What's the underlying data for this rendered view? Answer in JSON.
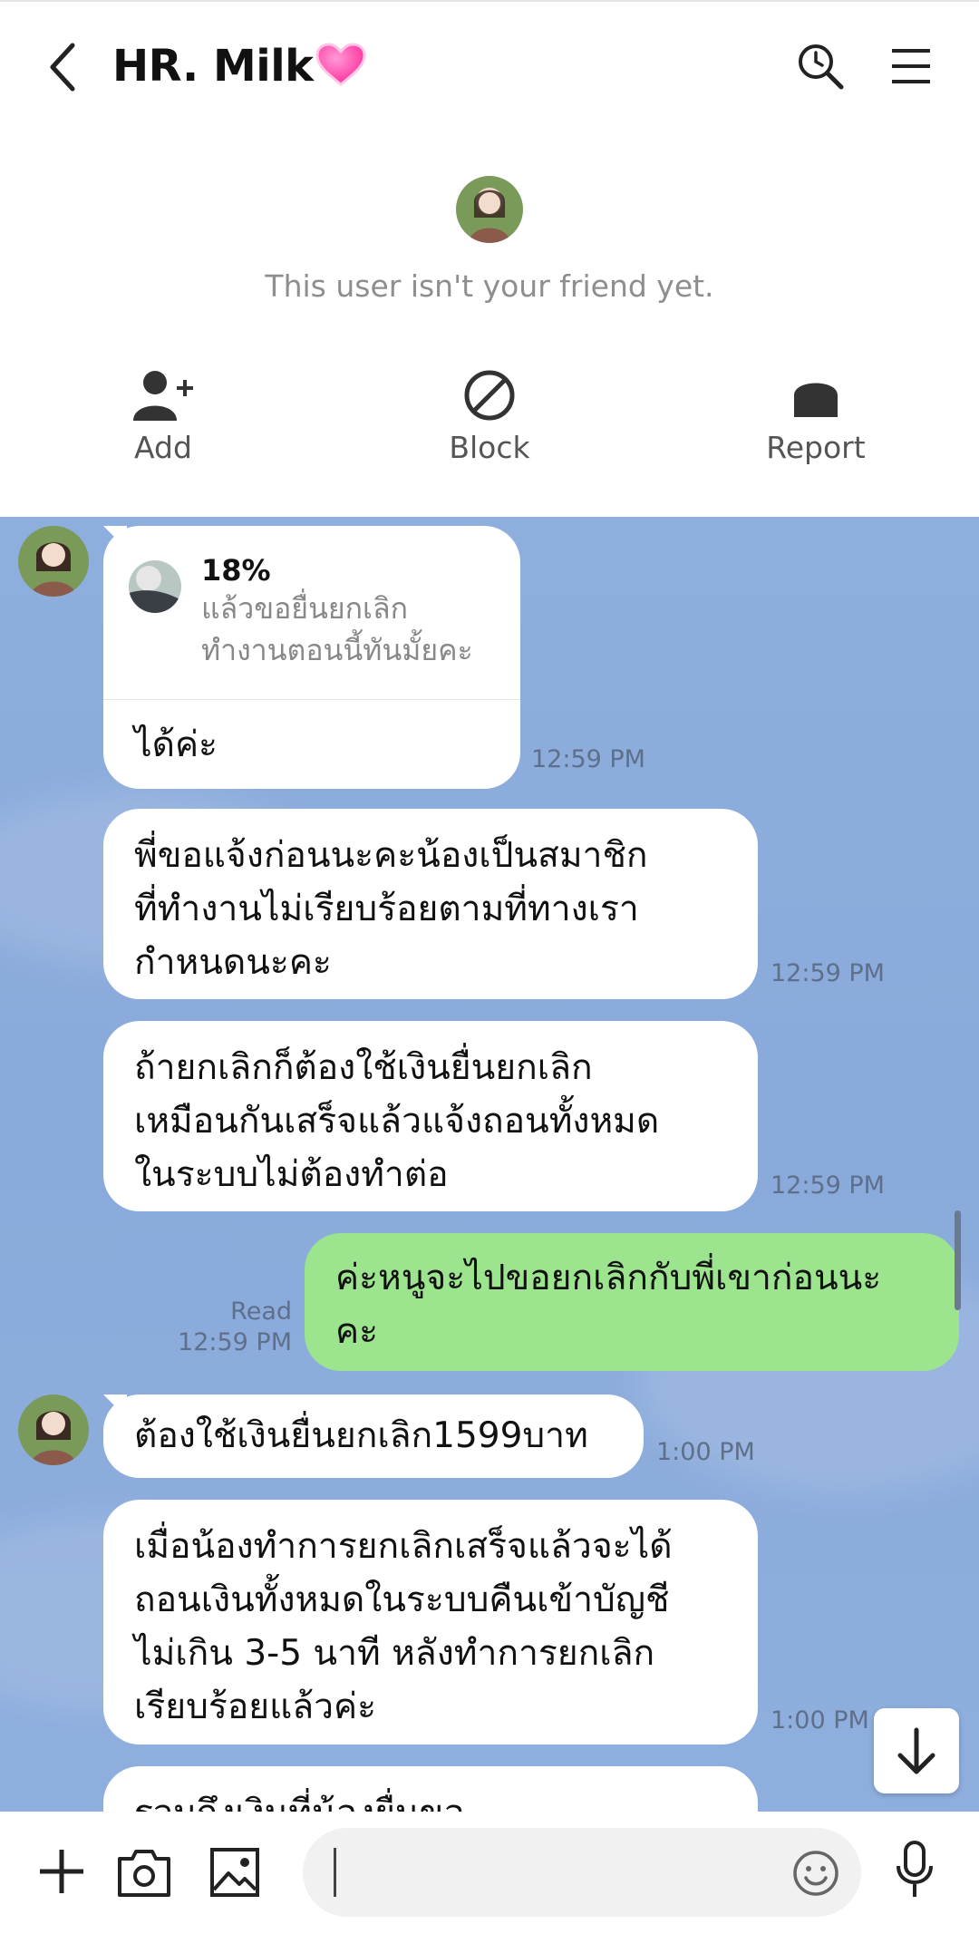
{
  "header": {
    "title": "HR. Milk"
  },
  "profile": {
    "status_text": "This user isn't your friend yet.",
    "actions": [
      {
        "label": "Add",
        "icon": "add-friend-icon"
      },
      {
        "label": "Block",
        "icon": "block-icon"
      },
      {
        "label": "Report",
        "icon": "report-icon"
      }
    ]
  },
  "messages": [
    {
      "from": "them",
      "reply_to": {
        "title": "18%",
        "line1": "แล้วขอยื่นยกเลิก",
        "line2": "ทำงานตอนนี้ทันมั้ยคะ"
      },
      "text": "ได้ค่ะ",
      "time": "12:59 PM"
    },
    {
      "from": "them",
      "lines": [
        "พี่ขอแจ้งก่อนนะคะน้องเป็นสมาชิก",
        "ที่ทำงานไม่เรียบร้อยตามที่ทางเรา",
        "กำหนดนะคะ"
      ],
      "time": "12:59 PM"
    },
    {
      "from": "them",
      "lines": [
        "ถ้ายกเลิกก็ต้องใช้เงินยื่นยกเลิก",
        "เหมือนกันเสร็จแล้วแจ้งถอนทั้งหมด",
        "ในระบบไม่ต้องทำต่อ"
      ],
      "time": "12:59 PM"
    },
    {
      "from": "me",
      "lines": [
        "ค่ะหนูจะไปขอยกเลิกกับพี่เขาก่อนนะ",
        "คะ"
      ],
      "read": "Read",
      "time": "12:59 PM"
    },
    {
      "from": "them",
      "lines": [
        "ต้องใช้เงินยื่นยกเลิก1599บาท"
      ],
      "time": "1:00 PM"
    },
    {
      "from": "them",
      "lines": [
        "เมื่อน้องทำการยกเลิกเสร็จแล้วจะได้",
        "ถอนเงินทั้งหมดในระบบคืนเข้าบัญชี",
        "ไม่เกิน 3-5 นาที หลังทำการยกเลิก",
        "เรียบร้อยแล้วค่ะ"
      ],
      "time": "1:00 PM"
    },
    {
      "from": "them",
      "lines": [
        "รวมถึงเงินที่น้องยื่นขอ"
      ],
      "time": ""
    }
  ],
  "composer": {
    "placeholder": ""
  },
  "colors": {
    "chat_bg": "#8eaedd",
    "my_bubble": "#9ce48d",
    "their_bubble": "#ffffff"
  }
}
